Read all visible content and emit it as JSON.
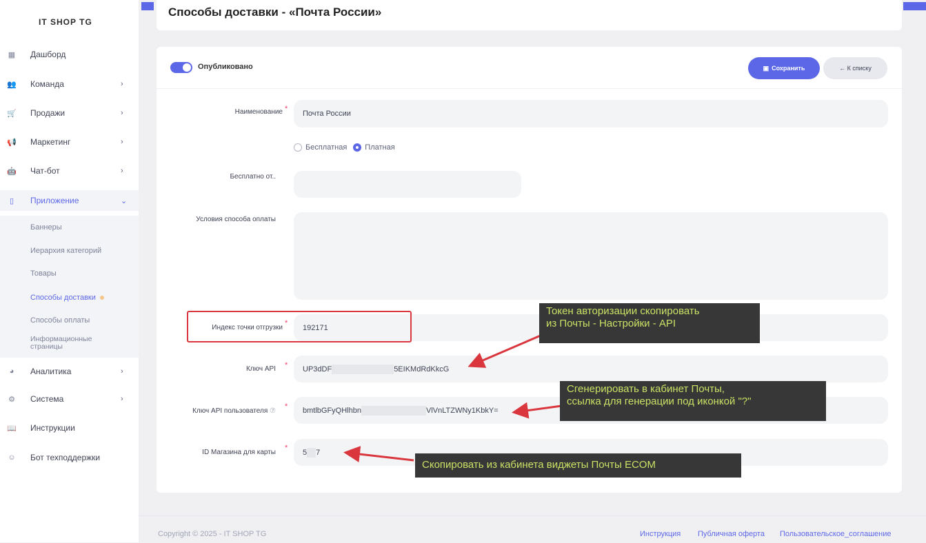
{
  "brand": "IT SHOP TG",
  "nav": [
    {
      "icon": "▦",
      "label": "Дашборд",
      "chev": ""
    },
    {
      "icon": "👥",
      "label": "Команда",
      "chev": "›"
    },
    {
      "icon": "🛒",
      "label": "Продажи",
      "chev": "›"
    },
    {
      "icon": "📢",
      "label": "Маркетинг",
      "chev": "›"
    },
    {
      "icon": "🤖",
      "label": "Чат-бот",
      "chev": "›"
    },
    {
      "icon": "▯",
      "label": "Приложение",
      "chev": "⌄"
    },
    {
      "icon": "◕",
      "label": "Аналитика",
      "chev": "›"
    },
    {
      "icon": "⚙",
      "label": "Система",
      "chev": "›"
    },
    {
      "icon": "📖",
      "label": "Инструкции",
      "chev": ""
    },
    {
      "icon": "☺",
      "label": "Бот техподдержки",
      "chev": ""
    }
  ],
  "subnav": [
    "Баннеры",
    "Иерархия категорий",
    "Товары",
    "Способы доставки",
    "Способы оплаты",
    "Информационные",
    "страницы"
  ],
  "page_title": "Способы доставки - «Почта России»",
  "published_label": "Опубликовано",
  "save_label": "Сохранить",
  "back_label": "← К списку",
  "fields": {
    "name_label": "Наименование",
    "name_value": "Почта России",
    "radio_free": "Бесплатная",
    "radio_paid": "Платная",
    "free_from_label": "Бесплатно от..",
    "terms_label": "Условия способа оплаты",
    "index_label": "Индекс точки отгрузки",
    "index_value": "192171",
    "api_key_label": "Ключ API",
    "api_key_start": "UP3dDF",
    "api_key_end": "5EIKMdRdKkcG",
    "user_key_label": "Ключ API пользователя",
    "user_key_start": "bmtlbGFyQHlhbn",
    "user_key_end": "VlVnLTZWNy1KbkY=",
    "shop_id_label": "ID Магазина для карты",
    "shop_id_start": "5",
    "shop_id_end": "7"
  },
  "notes": {
    "token_1": "Токен авторизации скопировать",
    "token_2": " из Почты - Настройки - API",
    "gen_1": "Сгенерировать в кабинет Почты,",
    "gen_2": "ссылка для генерации под иконкой \"?\"",
    "ecom": "Скопировать из кабинета виджеты Почты ECOM"
  },
  "footer": {
    "copyright": "Copyright © 2025 - IT SHOP TG",
    "links": [
      "Инструкция",
      "Публичная оферта",
      "Пользовательское_соглашение"
    ]
  },
  "colors": {
    "accent": "#5c67e8",
    "required": "#f1416c",
    "note_bg": "#373737",
    "note_text": "#c9e265",
    "arrow": "#d9363e"
  }
}
